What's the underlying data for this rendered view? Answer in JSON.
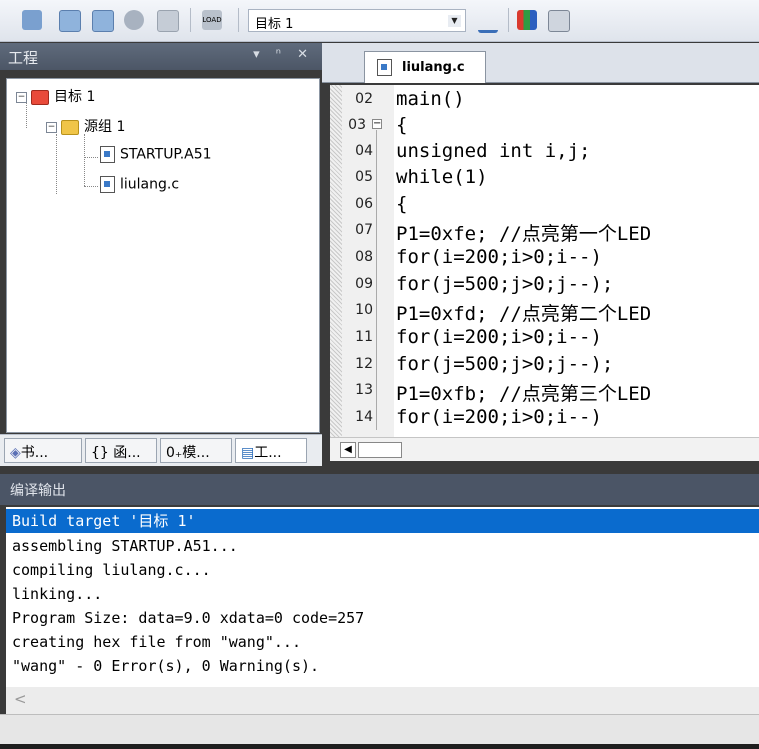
{
  "toolbar": {
    "target_value": "目标 1",
    "icons": [
      "translate-icon",
      "build-icon",
      "rebuild-icon",
      "batch-build-icon",
      "stop-build-icon",
      "download-icon",
      "target-options-icon",
      "file-extensions-icon",
      "manage-components-icon"
    ]
  },
  "project_panel": {
    "title": "工程",
    "controls": "▾ ⁿ ✕",
    "tree": {
      "target": "目标 1",
      "group": "源组 1",
      "files": [
        "STARTUP.A51",
        "liulang.c"
      ]
    },
    "tabs": [
      "书...",
      "{} 函...",
      "0₊模...",
      "工..."
    ]
  },
  "editor": {
    "tab_label": "liulang.c",
    "lines": [
      {
        "num": "02",
        "code": "main()"
      },
      {
        "num": "03",
        "code": "{"
      },
      {
        "num": "04",
        "code": "unsigned int i,j;"
      },
      {
        "num": "05",
        "code": "while(1)"
      },
      {
        "num": "06",
        "code": "{"
      },
      {
        "num": "07",
        "code": "P1=0xfe; //点亮第一个LED"
      },
      {
        "num": "08",
        "code": "for(i=200;i>0;i--)"
      },
      {
        "num": "09",
        "code": "for(j=500;j>0;j--);"
      },
      {
        "num": "10",
        "code": "P1=0xfd; //点亮第二个LED"
      },
      {
        "num": "11",
        "code": "for(i=200;i>0;i--)"
      },
      {
        "num": "12",
        "code": "for(j=500;j>0;j--);"
      },
      {
        "num": "13",
        "code": "P1=0xfb; //点亮第三个LED"
      },
      {
        "num": "14",
        "code": "for(i=200;i>0;i--)"
      }
    ]
  },
  "build_output": {
    "title": "编译输出",
    "lines": [
      "Build target '目标 1'",
      "assembling STARTUP.A51...",
      "compiling liulang.c...",
      "linking...",
      "Program Size: data=9.0 xdata=0 code=257",
      "creating hex file from \"wang\"...",
      "\"wang\" - 0 Error(s), 0 Warning(s)."
    ],
    "scroll_arrow": "<"
  }
}
